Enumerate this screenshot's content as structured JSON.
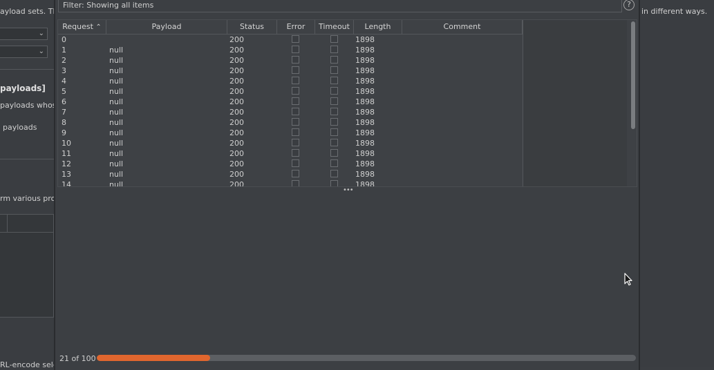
{
  "background": {
    "text_payload_sets": "ayload sets. The",
    "text_different_ways": "in different ways.",
    "text_payloads_heading": "payloads]",
    "text_payloads_whose": "payloads whose",
    "text_payloads": "payloads",
    "text_various": "rm various proce",
    "text_encode": "RL-encode selec"
  },
  "dialog": {
    "filter_text": "Filter: Showing all items",
    "help_label": "?",
    "columns": {
      "request": "Request",
      "payload": "Payload",
      "status": "Status",
      "error": "Error",
      "timeout": "Timeout",
      "length": "Length",
      "comment": "Comment"
    },
    "rows": [
      {
        "request": "0",
        "payload": "",
        "status": "200",
        "length": "1898"
      },
      {
        "request": "1",
        "payload": "null",
        "status": "200",
        "length": "1898"
      },
      {
        "request": "2",
        "payload": "null",
        "status": "200",
        "length": "1898"
      },
      {
        "request": "3",
        "payload": "null",
        "status": "200",
        "length": "1898"
      },
      {
        "request": "4",
        "payload": "null",
        "status": "200",
        "length": "1898"
      },
      {
        "request": "5",
        "payload": "null",
        "status": "200",
        "length": "1898"
      },
      {
        "request": "6",
        "payload": "null",
        "status": "200",
        "length": "1898"
      },
      {
        "request": "7",
        "payload": "null",
        "status": "200",
        "length": "1898"
      },
      {
        "request": "8",
        "payload": "null",
        "status": "200",
        "length": "1898"
      },
      {
        "request": "9",
        "payload": "null",
        "status": "200",
        "length": "1898"
      },
      {
        "request": "10",
        "payload": "null",
        "status": "200",
        "length": "1898"
      },
      {
        "request": "11",
        "payload": "null",
        "status": "200",
        "length": "1898"
      },
      {
        "request": "12",
        "payload": "null",
        "status": "200",
        "length": "1898"
      },
      {
        "request": "13",
        "payload": "null",
        "status": "200",
        "length": "1898"
      },
      {
        "request": "14",
        "payload": "null",
        "status": "200",
        "length": "1898"
      }
    ],
    "progress_text": "21 of 100",
    "progress_fraction": 0.21,
    "accent_color": "#e0662e"
  }
}
